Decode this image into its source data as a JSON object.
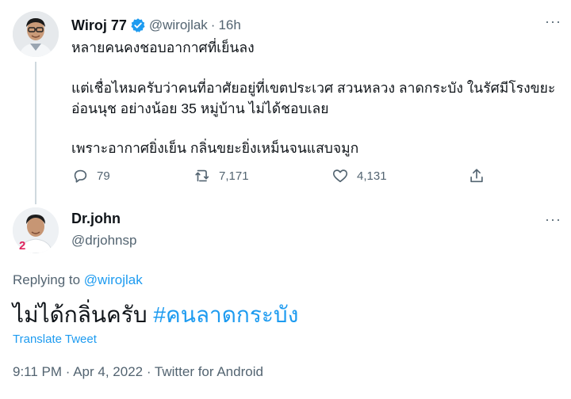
{
  "tweet1": {
    "author_name": "Wiroj 77",
    "handle": "@wirojlak",
    "time": "16h",
    "more_label": "···",
    "lines": [
      "หลายคนคงชอบอากาศที่เย็นลง",
      "แต่เชื่อไหมครับว่าคนที่อาศัยอยู่ที่เขตประเวศ สวนหลวง ลาดกระบัง ในรัศมีโรงขยะ",
      "อ่อนนุช อย่างน้อย 35 หมู่บ้าน ไม่ได้ชอบเลย",
      "เพราะอากาศยิ่งเย็น กลิ่นขยะยิ่งเหม็นจนแสบจมูก"
    ],
    "replies": "79",
    "retweets": "7,171",
    "likes": "4,131",
    "icons": [
      "reply-icon",
      "retweet-icon",
      "like-icon",
      "share-icon",
      "verified-icon"
    ]
  },
  "tweet2": {
    "author_name": "Dr.john",
    "handle": "@drjohnsp",
    "more_label": "···",
    "avatar_badge": "2",
    "replying_prefix": "Replying to ",
    "replying_handle": "@wirojlak",
    "text": "ไม่ได้กลิ่นครับ ",
    "hashtag": "#คนลาดกระบัง",
    "translate_label": "Translate Tweet",
    "meta": "9:11 PM · Apr 4, 2022 · Twitter for Android"
  },
  "colors": {
    "accent": "#1d9bf0",
    "secondary_text": "#536471",
    "primary_text": "#0f1419",
    "thread_line": "#cfd9de"
  }
}
